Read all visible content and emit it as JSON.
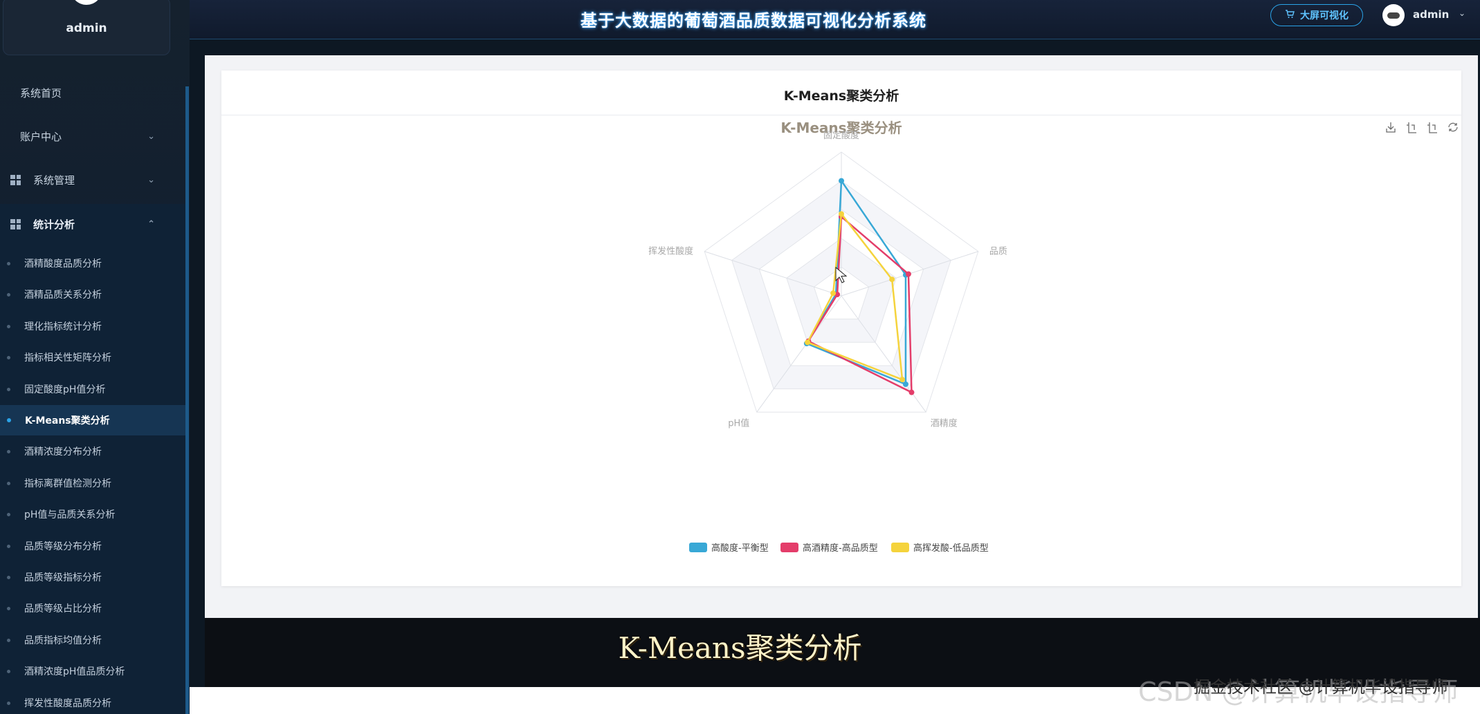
{
  "sidebar": {
    "user": "admin",
    "menu": [
      {
        "label": "系统首页"
      },
      {
        "label": "账户中心",
        "chevron": "down"
      },
      {
        "label": "系统管理",
        "chevron": "down",
        "icon": "grid-icon"
      },
      {
        "label": "统计分析",
        "chevron": "up",
        "icon": "grid-icon"
      }
    ],
    "submenu": [
      "酒精酸度品质分析",
      "酒精品质关系分析",
      "理化指标统计分析",
      "指标相关性矩阵分析",
      "固定酸度pH值分析",
      "K-Means聚类分析",
      "酒精浓度分布分析",
      "指标离群值检测分析",
      "pH值与品质关系分析",
      "品质等级分布分析",
      "品质等级指标分析",
      "品质等级占比分析",
      "品质指标均值分析",
      "酒精浓度pH值品质分析",
      "挥发性酸度品质分析"
    ],
    "active_index": 5
  },
  "header": {
    "title": "基于大数据的葡萄酒品质数据可视化分析系统",
    "bigscreen_button": "大屏可视化",
    "user": "admin"
  },
  "card": {
    "title": "K-Means聚类分析"
  },
  "chart_data": {
    "type": "radar",
    "title": "K-Means聚类分析",
    "indicators": [
      "固定酸度",
      "品质",
      "酒精度",
      "pH值",
      "挥发性酸度"
    ],
    "series": [
      {
        "name": "高酸度-平衡型",
        "color": "#38a8d6",
        "values": [
          0.8,
          0.47,
          0.76,
          0.41,
          0.04
        ]
      },
      {
        "name": "高酒精度-高品质型",
        "color": "#e43d6a",
        "values": [
          0.55,
          0.49,
          0.83,
          0.39,
          0.03
        ]
      },
      {
        "name": "高挥发酸-低品质型",
        "color": "#f5d33c",
        "values": [
          0.57,
          0.37,
          0.72,
          0.4,
          0.06
        ]
      }
    ],
    "legend_position": "bottom",
    "toolbox": [
      "download-icon",
      "zoom-icon",
      "zoom-reset-icon",
      "refresh-icon"
    ]
  },
  "caption": "K-Means聚类分析",
  "watermark": {
    "a": "CSDN @计算机毕设指导师",
    "b": "掘金技术社区 @计算机毕设指导师"
  }
}
